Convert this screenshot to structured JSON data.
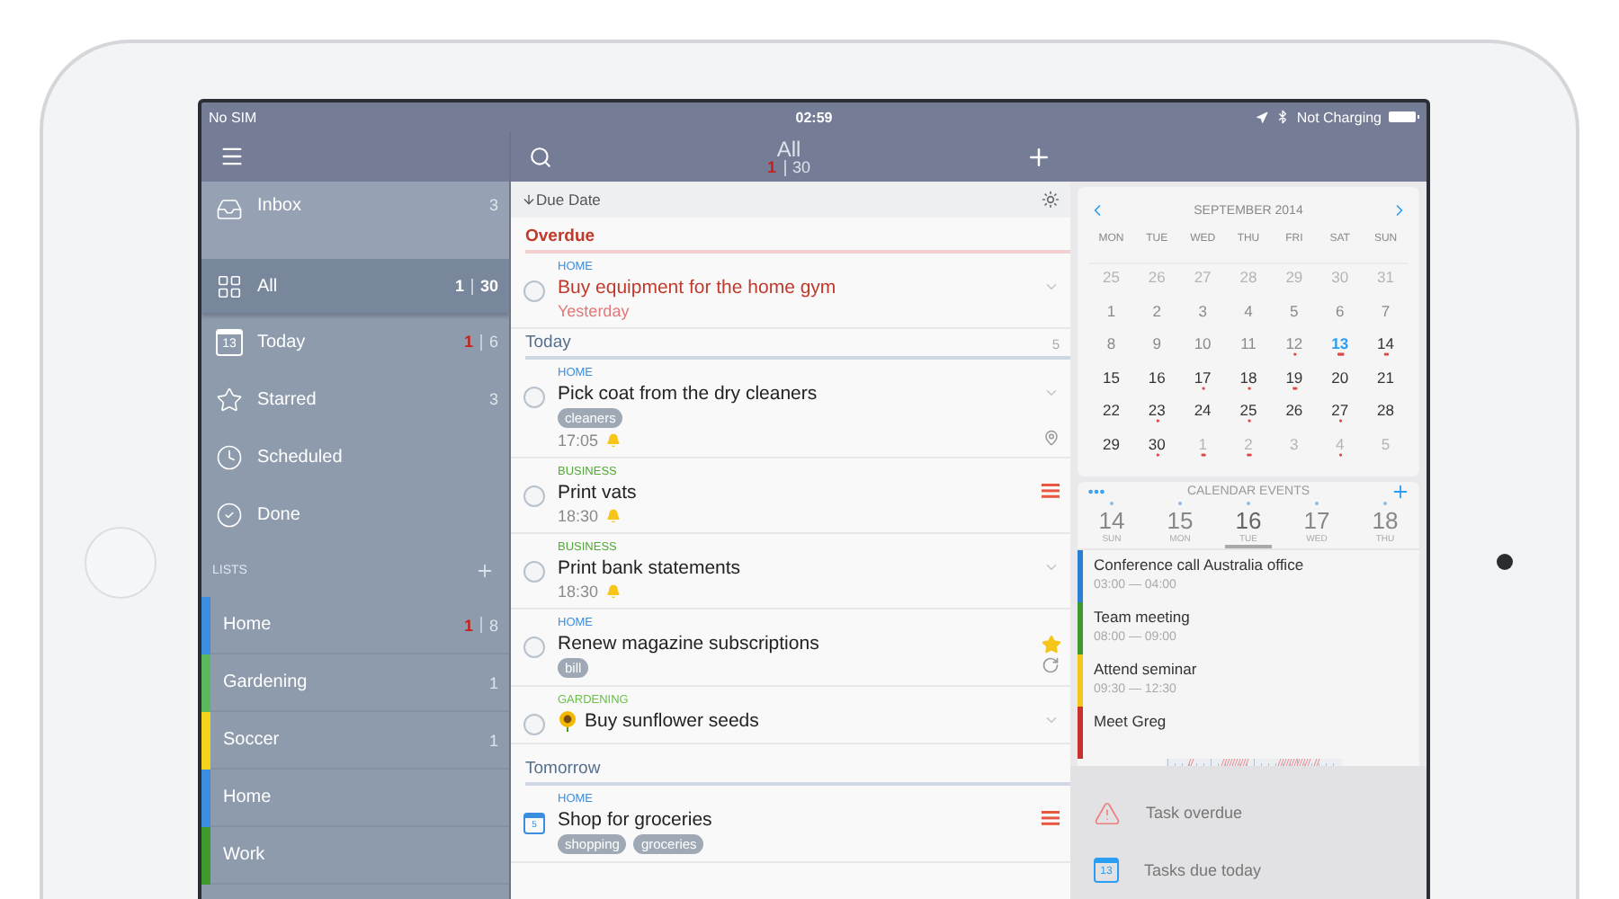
{
  "status_bar": {
    "carrier": "No SIM",
    "time": "02:59",
    "battery_text": "Not Charging"
  },
  "sidebar": {
    "items": [
      {
        "kind": "inbox",
        "label": "Inbox",
        "total": "3",
        "selected": false
      },
      {
        "kind": "all",
        "label": "All",
        "overdue": "1",
        "total": "30",
        "selected": true
      },
      {
        "kind": "today",
        "label": "Today",
        "icon_label": "13",
        "overdue": "1",
        "total": "6",
        "selected": false
      },
      {
        "kind": "starred",
        "label": "Starred",
        "total": "3",
        "selected": false
      },
      {
        "kind": "scheduled",
        "label": "Scheduled",
        "selected": false
      },
      {
        "kind": "done",
        "label": "Done",
        "selected": false
      }
    ],
    "lists_header": "LISTS",
    "lists": [
      {
        "name": "Home",
        "color": "#3a8ee0",
        "overdue": "1",
        "total": "8"
      },
      {
        "name": "Gardening",
        "color": "#5cb85c",
        "total": "1"
      },
      {
        "name": "Soccer",
        "color": "#f2d21b",
        "total": "1"
      },
      {
        "name": "Home",
        "color": "#3a8ee0"
      },
      {
        "name": "Work",
        "color": "#3f9a2e"
      }
    ]
  },
  "task_list": {
    "title": "All",
    "overdue": "1",
    "total": "30",
    "sort": "Due Date",
    "sections": [
      {
        "kind": "overdue",
        "title": "Overdue",
        "tasks": [
          {
            "kind": "plain",
            "list": "HOME",
            "color": "#3a8ee0",
            "checked": false,
            "title": "Buy equipment for the home gym",
            "overdue": true,
            "due": "Yesterday",
            "expandable": true
          }
        ]
      },
      {
        "kind": "normal",
        "title": "Today",
        "count": "5",
        "tasks": [
          {
            "kind": "plain",
            "list": "HOME",
            "color": "#3a8ee0",
            "checked": false,
            "title": "Pick coat from the dry cleaners",
            "overdue": false,
            "tags": [
              "cleaners"
            ],
            "time": "17:05",
            "alarm": true,
            "expandable": true,
            "location": true
          },
          {
            "kind": "plain",
            "list": "BUSINESS",
            "color": "#55a83a",
            "checked": false,
            "title": "Print vats",
            "overdue": false,
            "time": "18:30",
            "alarm": true,
            "priority": true
          },
          {
            "kind": "plain",
            "list": "BUSINESS",
            "color": "#55a83a",
            "checked": false,
            "title": "Print bank statements",
            "overdue": false,
            "time": "18:30",
            "alarm": true,
            "expandable": true
          },
          {
            "kind": "plain",
            "list": "HOME",
            "color": "#3a8ee0",
            "checked": false,
            "title": "Renew magazine subscriptions",
            "overdue": false,
            "tags": [
              "bill"
            ],
            "starred": true,
            "recurring": true
          },
          {
            "kind": "sunflower",
            "list": "GARDENING",
            "color": "#6cc04a",
            "checked": false,
            "title": "Buy sunflower seeds",
            "overdue": false,
            "expandable": true
          }
        ]
      },
      {
        "kind": "normal",
        "title": "Tomorrow",
        "tasks": [
          {
            "kind": "scheduled",
            "list": "HOME",
            "color": "#3a8ee0",
            "check_label": "5",
            "title": "Shop for groceries",
            "overdue": false,
            "tags": [
              "shopping",
              "groceries"
            ],
            "priority": true
          }
        ]
      }
    ]
  },
  "calendar": {
    "month": "SEPTEMBER 2014",
    "weekdays": [
      "MON",
      "TUE",
      "WED",
      "THU",
      "FRI",
      "SAT",
      "SUN"
    ],
    "weeks": [
      [
        {
          "day": "25",
          "kind": "other"
        },
        {
          "day": "26",
          "kind": "other"
        },
        {
          "day": "27",
          "kind": "other"
        },
        {
          "day": "28",
          "kind": "other"
        },
        {
          "day": "29",
          "kind": "other"
        },
        {
          "day": "30",
          "kind": "other"
        },
        {
          "day": "31",
          "kind": "other"
        }
      ],
      [
        {
          "day": "1",
          "kind": "past"
        },
        {
          "day": "2",
          "kind": "past"
        },
        {
          "day": "3",
          "kind": "past"
        },
        {
          "day": "4",
          "kind": "past"
        },
        {
          "day": "5",
          "kind": "past"
        },
        {
          "day": "6",
          "kind": "past"
        },
        {
          "day": "7",
          "kind": "past"
        }
      ],
      [
        {
          "day": "8",
          "kind": "past"
        },
        {
          "day": "9",
          "kind": "past"
        },
        {
          "day": "10",
          "kind": "past"
        },
        {
          "day": "11",
          "kind": "past"
        },
        {
          "day": "12",
          "kind": "past",
          "marks": "•"
        },
        {
          "day": "13",
          "kind": "today",
          "marks": "•••"
        },
        {
          "day": "14",
          "kind": "current",
          "marks": "••"
        }
      ],
      [
        {
          "day": "15",
          "kind": "current"
        },
        {
          "day": "16",
          "kind": "current"
        },
        {
          "day": "17",
          "kind": "current",
          "marks": "•"
        },
        {
          "day": "18",
          "kind": "current",
          "marks": "•"
        },
        {
          "day": "19",
          "kind": "current",
          "marks": "••"
        },
        {
          "day": "20",
          "kind": "current"
        },
        {
          "day": "21",
          "kind": "current"
        }
      ],
      [
        {
          "day": "22",
          "kind": "current"
        },
        {
          "day": "23",
          "kind": "current",
          "marks": "•"
        },
        {
          "day": "24",
          "kind": "current"
        },
        {
          "day": "25",
          "kind": "current",
          "marks": "•"
        },
        {
          "day": "26",
          "kind": "current"
        },
        {
          "day": "27",
          "kind": "current",
          "marks": "•"
        },
        {
          "day": "28",
          "kind": "current"
        }
      ],
      [
        {
          "day": "29",
          "kind": "current"
        },
        {
          "day": "30",
          "kind": "current",
          "marks": "•"
        },
        {
          "day": "1",
          "kind": "other",
          "marks": "••"
        },
        {
          "day": "2",
          "kind": "other",
          "marks": "••"
        },
        {
          "day": "3",
          "kind": "other"
        },
        {
          "day": "4",
          "kind": "other",
          "marks": "•"
        },
        {
          "day": "5",
          "kind": "other"
        }
      ]
    ]
  },
  "events_panel": {
    "title": "CALENDAR EVENTS",
    "days": [
      {
        "num": "14",
        "weekday": "SUN",
        "selected": false
      },
      {
        "num": "15",
        "weekday": "MON",
        "selected": false
      },
      {
        "num": "16",
        "weekday": "TUE",
        "selected": true
      },
      {
        "num": "17",
        "weekday": "WED",
        "selected": false
      },
      {
        "num": "18",
        "weekday": "THU",
        "selected": false
      }
    ],
    "events": [
      {
        "title": "Conference call Australia office",
        "time": "03:00 — 04:00",
        "color": "#2a7fd4"
      },
      {
        "title": "Team meeting",
        "time": "08:00 — 09:00",
        "color": "#3f9a2e"
      },
      {
        "title": "Attend seminar",
        "time": "09:30 — 12:30",
        "color": "#f5c518"
      },
      {
        "title": "Meet Greg",
        "color": "#c9302c"
      }
    ]
  },
  "notifications": [
    {
      "kind": "warning",
      "text": "Task overdue"
    },
    {
      "kind": "calendar",
      "icon_label": "13",
      "text": "Tasks due today"
    }
  ]
}
